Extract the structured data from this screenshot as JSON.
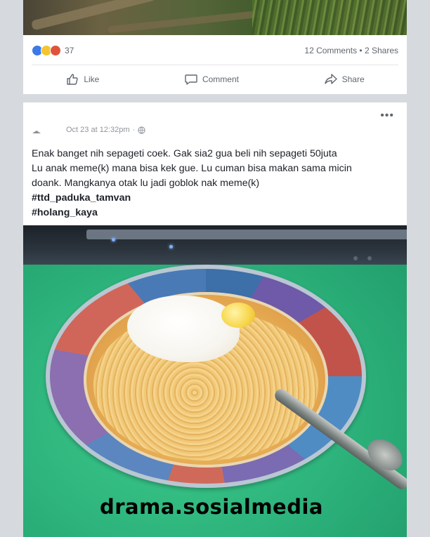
{
  "previous_post": {
    "reaction_count": "37",
    "stats": "12 Comments • 2 Shares",
    "actions": {
      "like": "Like",
      "comment": "Comment",
      "share": "Share"
    }
  },
  "post": {
    "timestamp": "Oct 23 at 12:32pm",
    "privacy_separator": "·",
    "text_lines": [
      "Enak banget nih sepageti coek. Gak sia2 gua beli nih sepageti 50juta",
      "Lu anak meme(k) mana bisa kek gue. Lu cuman bisa makan sama micin",
      "doank. Mangkanya otak lu jadi goblok nak meme(k)"
    ],
    "hashtags": [
      "#ttd_paduka_tamvan",
      "#holang_kaya"
    ]
  },
  "watermark": "drama.sosialmedia",
  "colors": {
    "page_bg": "#d6dadf",
    "card_bg": "#ffffff",
    "meta_text": "#606770",
    "like_reaction": "#3b7ae8"
  },
  "icons": [
    "like-reaction-icon",
    "haha-reaction-icon",
    "angry-reaction-icon",
    "thumbs-up-icon",
    "comment-icon",
    "share-icon",
    "more-options-icon",
    "globe-icon"
  ]
}
